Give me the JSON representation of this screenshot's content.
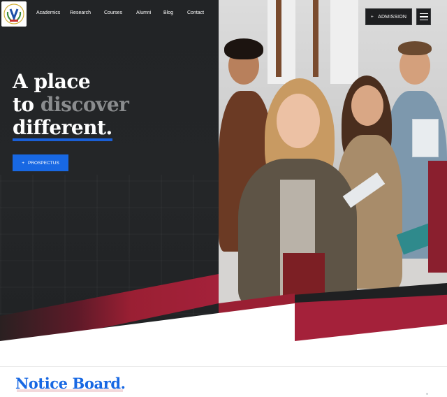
{
  "nav": {
    "items": [
      "Academics",
      "Research",
      "Courses",
      "Alumni",
      "Blog",
      "Contact"
    ],
    "admission_label": "ADMISSION",
    "admission_icon": "+"
  },
  "hero": {
    "line1": "A place",
    "line2_a": "to",
    "line2_b": "discover",
    "line3": "different.",
    "prospectus_label": "PROSPECTUS",
    "prospectus_icon": "+"
  },
  "section": {
    "notice_title": "Notice Board."
  },
  "colors": {
    "accent_blue": "#1868e3",
    "brand_red": "#9a1f33",
    "dark_bg": "#232527"
  }
}
